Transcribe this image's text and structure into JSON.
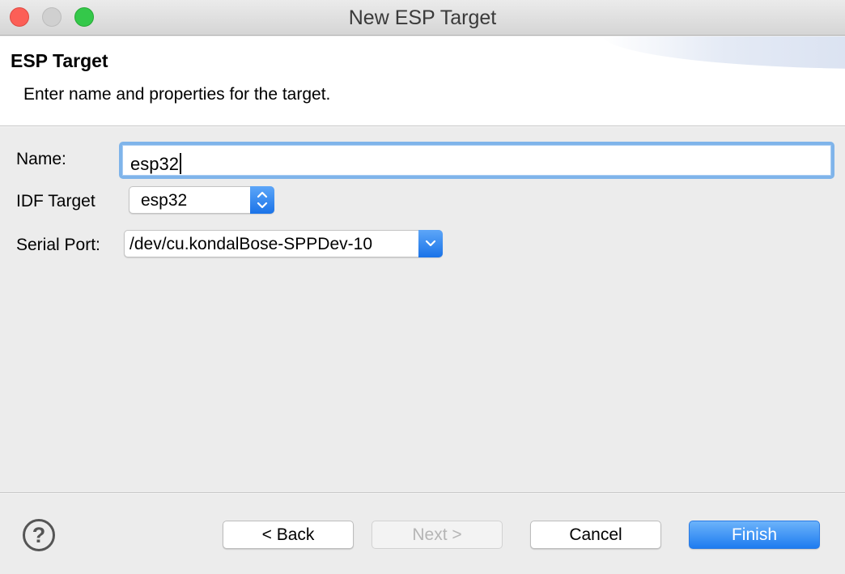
{
  "window": {
    "title": "New ESP Target",
    "controls": [
      "close",
      "minimize",
      "zoom"
    ]
  },
  "banner": {
    "title": "ESP Target",
    "description": "Enter name and properties for the target."
  },
  "form": {
    "name_label": "Name:",
    "name_value": "esp32",
    "idf_target_label": "IDF Target",
    "idf_target_value": "esp32",
    "serial_port_label": "Serial Port:",
    "serial_port_value": "/dev/cu.kondalBose-SPPDev-10"
  },
  "footer": {
    "help_icon": "?",
    "back_label": "< Back",
    "next_label": "Next >",
    "cancel_label": "Cancel",
    "finish_label": "Finish"
  },
  "colors": {
    "accent": "#1e7cf0",
    "focus_ring": "#7fb4ea",
    "close": "#fc5f57",
    "zoom": "#34c84a"
  }
}
